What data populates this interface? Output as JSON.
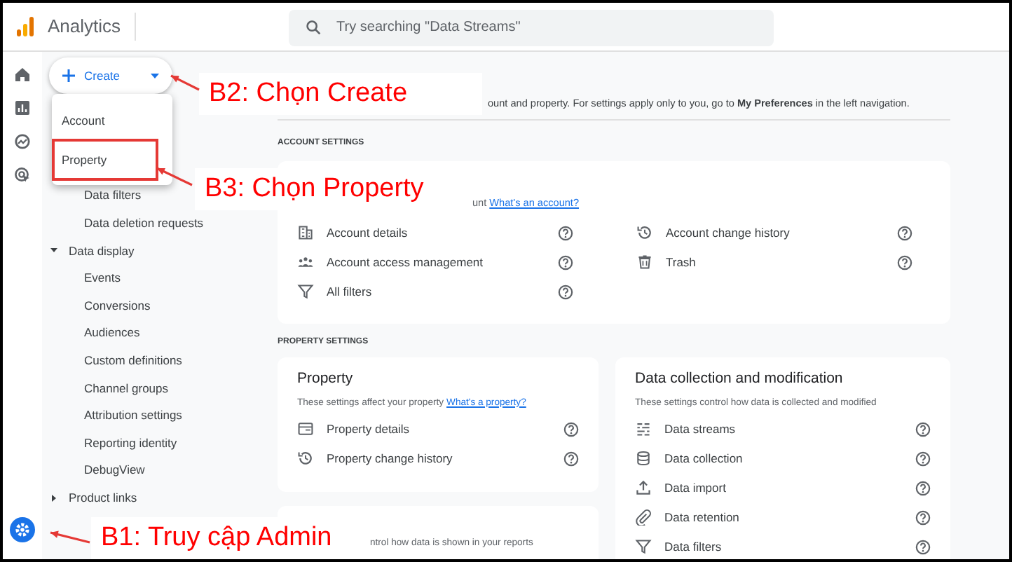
{
  "header": {
    "product": "Analytics",
    "search": {
      "placeholder": "Try searching \"Data Streams\""
    }
  },
  "create_button": {
    "label": "Create"
  },
  "create_menu": [
    {
      "label": "Account",
      "selected": false
    },
    {
      "label": "Property",
      "selected": true
    }
  ],
  "sidebar": [
    {
      "label": "Data filters",
      "kind": "link"
    },
    {
      "label": "Data deletion requests",
      "kind": "link"
    },
    {
      "label": "Data display",
      "kind": "group",
      "expanded": true,
      "children": [
        {
          "label": "Events"
        },
        {
          "label": "Conversions"
        },
        {
          "label": "Audiences"
        },
        {
          "label": "Custom definitions"
        },
        {
          "label": "Channel groups"
        },
        {
          "label": "Attribution settings"
        },
        {
          "label": "Reporting identity"
        },
        {
          "label": "DebugView"
        }
      ]
    },
    {
      "label": "Product links",
      "kind": "group",
      "expanded": false
    }
  ],
  "intro": "ount and property. For settings apply only to you, go to **My Preferences** in the left navigation.",
  "account_settings": {
    "heading": "ACCOUNT SETTINGS",
    "description": "unt",
    "link": "What's an account?",
    "items": [
      {
        "label": "Account details"
      },
      {
        "label": "Account change history"
      },
      {
        "label": "Account access management"
      },
      {
        "label": "Trash"
      },
      {
        "label": "All filters"
      }
    ]
  },
  "property_settings": {
    "heading": "PROPERTY SETTINGS",
    "property_card": {
      "title": "Property",
      "description": "These settings affect your property",
      "link": "What's a property?",
      "items": [
        {
          "label": "Property details"
        },
        {
          "label": "Property change history"
        }
      ]
    },
    "data_card": {
      "title": "Data collection and modification",
      "description": "These settings control how data is collected and modified",
      "items": [
        {
          "label": "Data streams"
        },
        {
          "label": "Data collection"
        },
        {
          "label": "Data import"
        },
        {
          "label": "Data retention"
        },
        {
          "label": "Data filters"
        }
      ]
    },
    "display_card": {
      "description": "ntrol how data is shown in your reports"
    }
  },
  "annotations": [
    {
      "text": "B2: Chọn Create"
    },
    {
      "text": "B3: Chọn Property"
    },
    {
      "text": "B1: Truy cập Admin"
    }
  ]
}
